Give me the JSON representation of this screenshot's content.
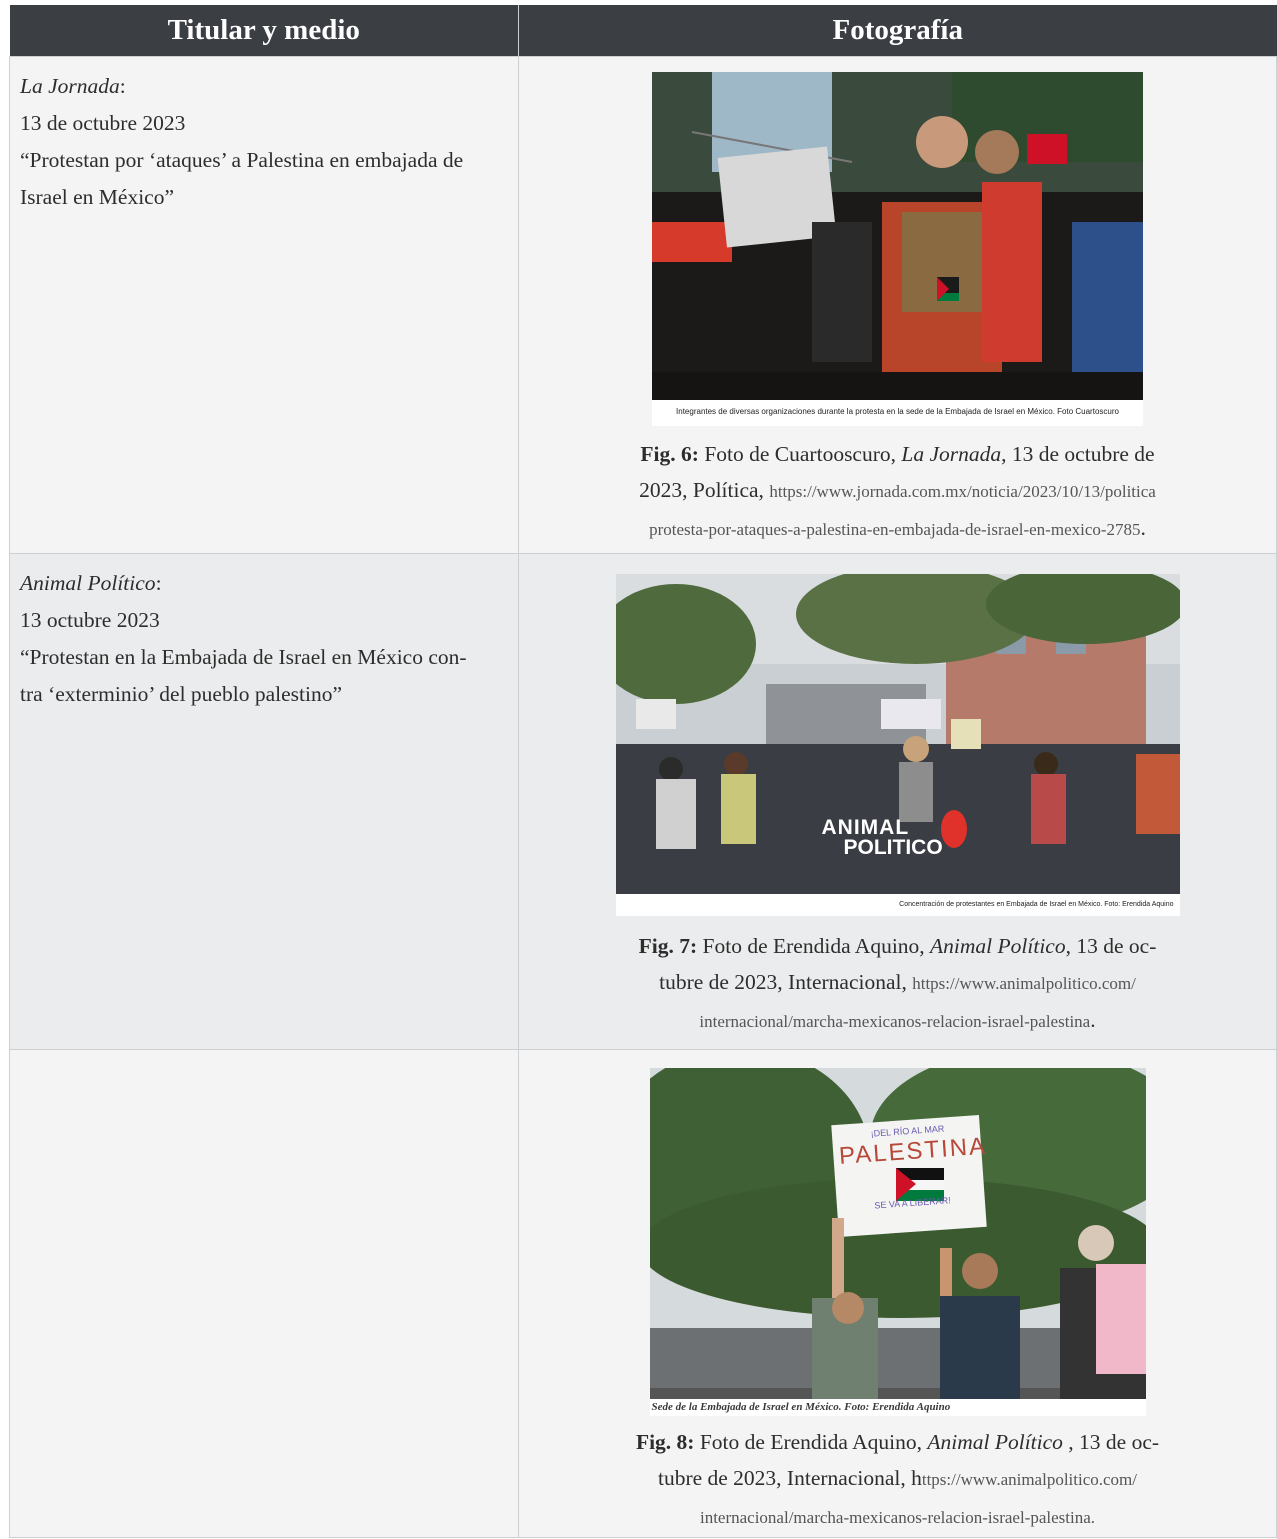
{
  "table": {
    "headers": [
      "Titular y medio",
      "Fotografía"
    ],
    "rows": [
      {
        "outlet": "La Jornada",
        "outlet_suffix": ":",
        "date": "13 de octubre 2023",
        "headline_line1": "“Protestan por ‘ataques’ a Palestina en embajada de",
        "headline_line2": "Israel en México”",
        "photo_caption": "Integrantes de diversas organizaciones durante la protesta en la sede de la Embajada de Israel en México. Foto Cuartoscuro",
        "fig_label": "Fig. 6:",
        "fig_text_a": " Foto de Cuartooscuro, ",
        "fig_italic": "La Jornada",
        "fig_text_b": ", 13 de octubre de",
        "fig_line2_a": "2023, Política, ",
        "fig_url_1": "https://www.jornada.com.mx/noticia/2023/10/13/politica",
        "fig_url_2": "protesta-por-ataques-a-palestina-en-embajada-de-israel-en-mexico-2785",
        "fig_end": "."
      },
      {
        "outlet": "Animal Político",
        "outlet_suffix": ":",
        "date": "13 octubre 2023",
        "headline_line1": "“Protestan en la Embajada de Israel en México con-",
        "headline_line2": "tra ‘exterminio’ del pueblo palestino”",
        "photo_caption": "Concentración de protestantes en Embajada de Israel en México. Foto: Erendida Aquino",
        "watermark_1": "ANIMAL",
        "watermark_2": "POLITICO",
        "fig_label": "Fig. 7:",
        "fig_text_a": " Foto de Erendida Aquino, ",
        "fig_italic": "Animal Político",
        "fig_text_b": ", 13 de oc-",
        "fig_line2_a": "tubre de 2023, Internacional, ",
        "fig_url_1": "https://www.animalpolitico.com/",
        "fig_url_2": "internacional/marcha-mexicanos-relacion-israel-palestina",
        "fig_end": "."
      },
      {
        "photo_caption": "Sede de la Embajada de Israel en México. Foto: Erendida Aquino",
        "sign_text_1": "¡DEL RÍO AL MAR",
        "sign_text_2": "PALESTINA",
        "sign_text_3": "SE VA A LIBERAR!",
        "fig_label": "Fig. 8:",
        "fig_text_a": " Foto de Erendida Aquino, ",
        "fig_italic": "Animal Político",
        "fig_text_b": " , 13 de oc-",
        "fig_line2_a": "tubre de 2023, Internacional, h",
        "fig_url_1": "ttps://www.animalpolitico.com/",
        "fig_url_2": "internacional/marcha-mexicanos-relacion-israel-palestina.",
        "fig_end": ""
      }
    ]
  },
  "colors": {
    "header_bg": "#3b3f44",
    "row_light": "#f4f4f4",
    "row_dark": "#ebeced",
    "flag_red": "#ce1126",
    "flag_green": "#007a3d"
  }
}
